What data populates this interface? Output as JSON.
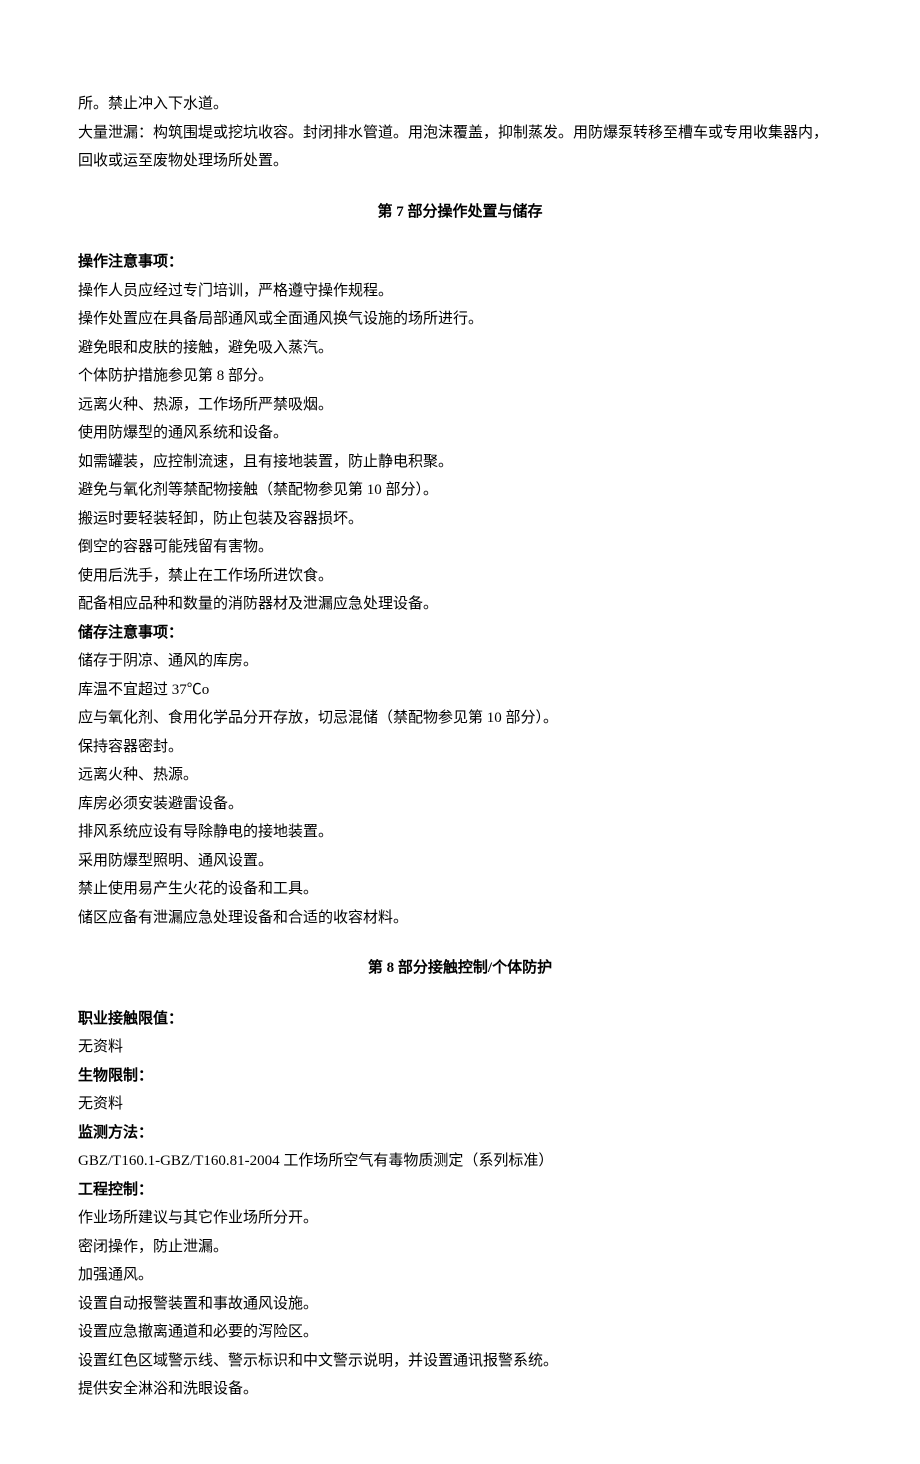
{
  "intro": [
    "所。禁止冲入下水道。",
    "大量泄漏：构筑围堤或挖坑收容。封闭排水管道。用泡沫覆盖，抑制蒸发。用防爆泵转移至槽车或专用收集器内，回收或运至废物处理场所处置。"
  ],
  "section7": {
    "heading": "第 7 部分操作处置与储存",
    "opLabel": "操作注意事项：",
    "opItems": [
      "操作人员应经过专门培训，严格遵守操作规程。",
      "操作处置应在具备局部通风或全面通风换气设施的场所进行。",
      "避免眼和皮肤的接触，避免吸入蒸汽。",
      "个体防护措施参见第 8 部分。",
      "远离火种、热源，工作场所严禁吸烟。",
      "使用防爆型的通风系统和设备。",
      "如需罐装，应控制流速，且有接地装置，防止静电积聚。",
      "避免与氧化剂等禁配物接触（禁配物参见第 10 部分）。",
      "搬运时要轻装轻卸，防止包装及容器损坏。",
      "倒空的容器可能残留有害物。",
      "使用后洗手，禁止在工作场所进饮食。",
      "配备相应品种和数量的消防器材及泄漏应急处理设备。"
    ],
    "storageLabel": "储存注意事项：",
    "storageItems": [
      "储存于阴凉、通风的库房。",
      "库温不宜超过 37℃o",
      "应与氧化剂、食用化学品分开存放，切忌混储（禁配物参见第 10 部分）。",
      "保持容器密封。",
      "远离火种、热源。",
      "库房必须安装避雷设备。",
      "排风系统应设有导除静电的接地装置。",
      "采用防爆型照明、通风设置。",
      "禁止使用易产生火花的设备和工具。",
      "储区应备有泄漏应急处理设备和合适的收容材料。"
    ]
  },
  "section8": {
    "heading": "第 8 部分接触控制/个体防护",
    "occLabel": "职业接触限值：",
    "occValue": "无资料",
    "bioLabel": "生物限制：",
    "bioValue": "无资料",
    "monLabel": "监测方法：",
    "monValue": "GBZ/T160.1-GBZ/T160.81-2004 工作场所空气有毒物质测定（系列标准）",
    "engLabel": "工程控制：",
    "engItems": [
      "作业场所建议与其它作业场所分开。",
      "密闭操作，防止泄漏。",
      "加强通风。",
      "设置自动报警装置和事故通风设施。",
      "设置应急撤离通道和必要的泻险区。",
      "设置红色区域警示线、警示标识和中文警示说明，并设置通讯报警系统。",
      "提供安全淋浴和洗眼设备。"
    ]
  }
}
